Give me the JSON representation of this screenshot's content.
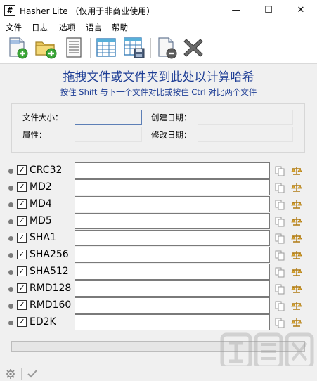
{
  "window": {
    "app_icon": "#",
    "title": "Hasher Lite （仅用于非商业使用）",
    "minimize_glyph": "—",
    "maximize_glyph": "☐",
    "close_glyph": "✕"
  },
  "menu": [
    "文件",
    "日志",
    "选项",
    "语言",
    "帮助"
  ],
  "toolbar": {
    "buttons": [
      "add-file-icon",
      "add-folder-icon",
      "document-icon",
      "table-icon",
      "save-table-icon",
      "remove-icon",
      "clear-all-icon"
    ]
  },
  "drop": {
    "title": "拖拽文件或文件夹到此处以计算哈希",
    "subtitle": "按住 Shift 与下一个文件对比或按住 Ctrl 对比两个文件"
  },
  "info": {
    "size_label": "文件大小：",
    "size_value": "",
    "attr_label": "属性：",
    "attr_value": "",
    "created_label": "创建日期：",
    "created_value": "",
    "modified_label": "修改日期：",
    "modified_value": ""
  },
  "hashes": [
    {
      "name": "CRC32",
      "checked": true,
      "value": ""
    },
    {
      "name": "MD2",
      "checked": true,
      "value": ""
    },
    {
      "name": "MD4",
      "checked": true,
      "value": ""
    },
    {
      "name": "MD5",
      "checked": true,
      "value": ""
    },
    {
      "name": "SHA1",
      "checked": true,
      "value": ""
    },
    {
      "name": "SHA256",
      "checked": true,
      "value": ""
    },
    {
      "name": "SHA512",
      "checked": true,
      "value": ""
    },
    {
      "name": "RMD128",
      "checked": true,
      "value": ""
    },
    {
      "name": "RMD160",
      "checked": true,
      "value": ""
    },
    {
      "name": "ED2K",
      "checked": true,
      "value": ""
    }
  ],
  "progress": {
    "fraction": 0
  },
  "colors": {
    "accent": "#1d3d95",
    "progress": "#06b025"
  },
  "statusbar": {
    "icons": [
      "settings-gear-icon",
      "checkmark-icon"
    ]
  }
}
